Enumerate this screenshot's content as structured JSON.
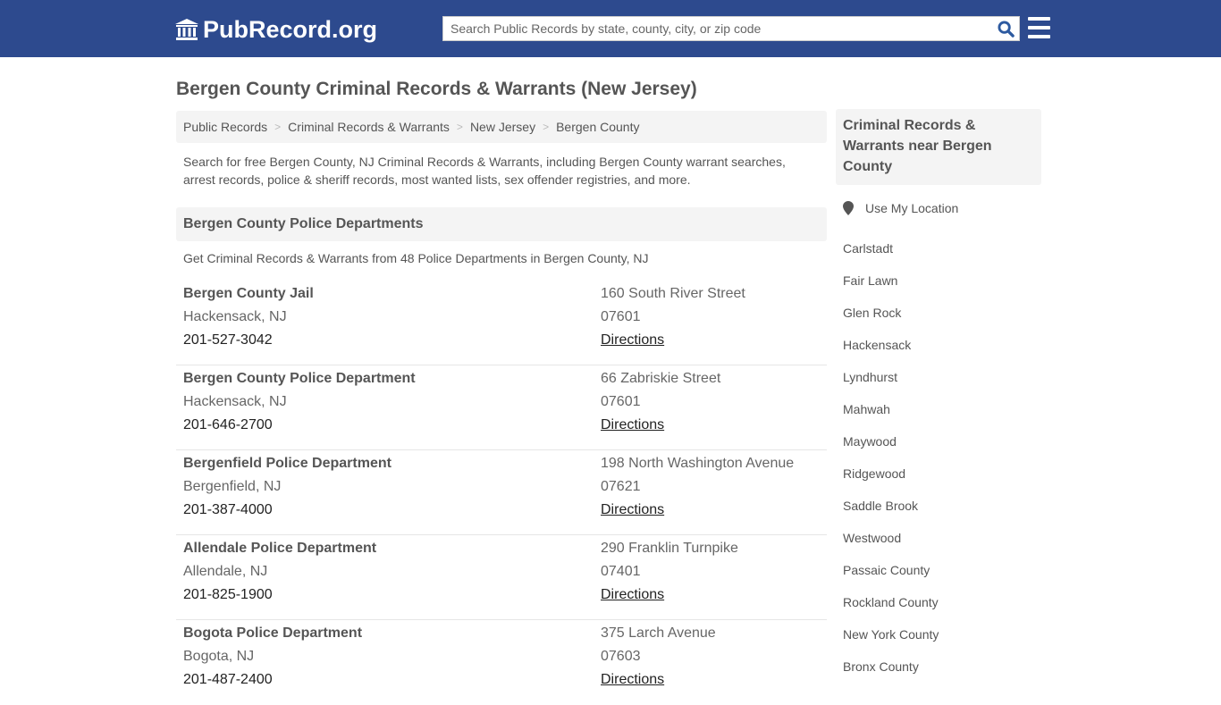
{
  "header": {
    "logo_text": "PubRecord.org",
    "search_placeholder": "Search Public Records by state, county, city, or zip code",
    "colors": {
      "brand": "#2d4a8e",
      "search_icon": "#2d5aa0"
    }
  },
  "page": {
    "title": "Bergen County Criminal Records & Warrants (New Jersey)",
    "breadcrumb": [
      {
        "label": "Public Records"
      },
      {
        "label": "Criminal Records & Warrants"
      },
      {
        "label": "New Jersey"
      },
      {
        "label": "Bergen County"
      }
    ],
    "breadcrumb_separator": ">",
    "intro": "Search for free Bergen County, NJ Criminal Records & Warrants, including Bergen County warrant searches, arrest records, police & sheriff records, most wanted lists, sex offender registries, and more."
  },
  "section": {
    "heading": "Bergen County Police Departments",
    "subheading": "Get Criminal Records & Warrants from 48 Police Departments in Bergen County, NJ",
    "entries": [
      {
        "name": "Bergen County Jail",
        "city": "Hackensack, NJ",
        "phone": "201-527-3042",
        "address": "160 South River Street",
        "zip": "07601",
        "link": "Directions"
      },
      {
        "name": "Bergen County Police Department",
        "city": "Hackensack, NJ",
        "phone": "201-646-2700",
        "address": "66 Zabriskie Street",
        "zip": "07601",
        "link": "Directions"
      },
      {
        "name": "Bergenfield Police Department",
        "city": "Bergenfield, NJ",
        "phone": "201-387-4000",
        "address": "198 North Washington Avenue",
        "zip": "07621",
        "link": "Directions"
      },
      {
        "name": "Allendale Police Department",
        "city": "Allendale, NJ",
        "phone": "201-825-1900",
        "address": "290 Franklin Turnpike",
        "zip": "07401",
        "link": "Directions"
      },
      {
        "name": "Bogota Police Department",
        "city": "Bogota, NJ",
        "phone": "201-487-2400",
        "address": "375 Larch Avenue",
        "zip": "07603",
        "link": "Directions"
      }
    ]
  },
  "sidebar": {
    "heading": "Criminal Records & Warrants near Bergen County",
    "use_location": "Use My Location",
    "items": [
      "Carlstadt",
      "Fair Lawn",
      "Glen Rock",
      "Hackensack",
      "Lyndhurst",
      "Mahwah",
      "Maywood",
      "Ridgewood",
      "Saddle Brook",
      "Westwood",
      "Passaic County",
      "Rockland County",
      "New York County",
      "Bronx County"
    ]
  }
}
